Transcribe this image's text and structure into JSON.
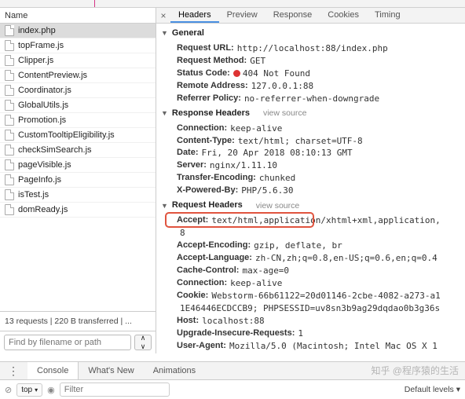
{
  "left": {
    "header": "Name",
    "files": [
      "index.php",
      "topFrame.js",
      "Clipper.js",
      "ContentPreview.js",
      "Coordinator.js",
      "GlobalUtils.js",
      "Promotion.js",
      "CustomTooltipEligibility.js",
      "checkSimSearch.js",
      "pageVisible.js",
      "PageInfo.js",
      "isTest.js",
      "domReady.js"
    ],
    "status": "13 requests | 220 B transferred | ...",
    "filter_placeholder": "Find by filename or path"
  },
  "tabs": [
    "Headers",
    "Preview",
    "Response",
    "Cookies",
    "Timing"
  ],
  "general": {
    "title": "General",
    "items": [
      {
        "k": "Request URL:",
        "v": "http://localhost:88/index.php"
      },
      {
        "k": "Request Method:",
        "v": "GET"
      },
      {
        "k": "Status Code:",
        "v": "404 Not Found",
        "dot": true
      },
      {
        "k": "Remote Address:",
        "v": "127.0.0.1:88"
      },
      {
        "k": "Referrer Policy:",
        "v": "no-referrer-when-downgrade"
      }
    ]
  },
  "response_headers": {
    "title": "Response Headers",
    "view_source": "view source",
    "items": [
      {
        "k": "Connection:",
        "v": "keep-alive"
      },
      {
        "k": "Content-Type:",
        "v": "text/html; charset=UTF-8"
      },
      {
        "k": "Date:",
        "v": "Fri, 20 Apr 2018 08:10:13 GMT"
      },
      {
        "k": "Server:",
        "v": "nginx/1.11.10"
      },
      {
        "k": "Transfer-Encoding:",
        "v": "chunked"
      },
      {
        "k": "X-Powered-By:",
        "v": "PHP/5.6.30"
      }
    ]
  },
  "request_headers": {
    "title": "Request Headers",
    "view_source": "view source",
    "items": [
      {
        "k": "Accept:",
        "v": "text/html,application/xhtml+xml,application,"
      },
      {
        "k": "",
        "v": "8"
      },
      {
        "k": "Accept-Encoding:",
        "v": "gzip, deflate, br"
      },
      {
        "k": "Accept-Language:",
        "v": "zh-CN,zh;q=0.8,en-US;q=0.6,en;q=0.4"
      },
      {
        "k": "Cache-Control:",
        "v": "max-age=0"
      },
      {
        "k": "Connection:",
        "v": "keep-alive"
      },
      {
        "k": "Cookie:",
        "v": "Webstorm-66b61122=20d01146-2cbe-4082-a273-a1"
      },
      {
        "k": "",
        "v": "1E46446ECDCCB9; PHPSESSID=uv8sn3b9ag29dqdao0b3g36s"
      },
      {
        "k": "Host:",
        "v": "localhost:88"
      },
      {
        "k": "Upgrade-Insecure-Requests:",
        "v": "1"
      },
      {
        "k": "User-Agent:",
        "v": "Mozilla/5.0 (Macintosh; Intel Mac OS X 1"
      }
    ]
  },
  "drawer": {
    "tabs": [
      "Console",
      "What's New",
      "Animations"
    ]
  },
  "console": {
    "context": "top",
    "filter_placeholder": "Filter",
    "levels": "Default levels"
  },
  "watermark": "知乎 @程序猿的生活"
}
